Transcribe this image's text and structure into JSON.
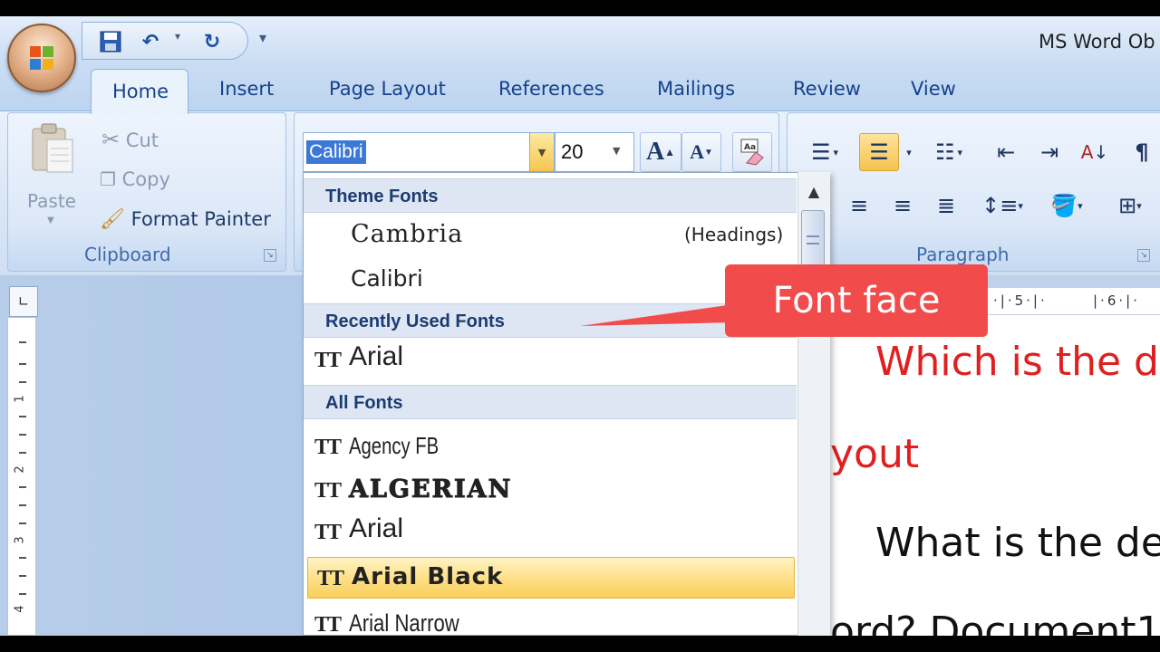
{
  "window": {
    "title": "MS Word Ob"
  },
  "qat": {
    "customize_glyph": "▾"
  },
  "tabs": [
    {
      "label": "Home"
    },
    {
      "label": "Insert"
    },
    {
      "label": "Page Layout"
    },
    {
      "label": "References"
    },
    {
      "label": "Mailings"
    },
    {
      "label": "Review"
    },
    {
      "label": "View"
    }
  ],
  "clipboard": {
    "paste": "Paste",
    "cut": "Cut",
    "copy": "Copy",
    "format_painter": "Format Painter",
    "group_label": "Clipboard"
  },
  "font": {
    "name_value": "Calibri",
    "size_value": "20"
  },
  "paragraph": {
    "group_label": "Paragraph"
  },
  "dropdown": {
    "theme_fonts_header": "Theme Fonts",
    "theme_fonts": [
      {
        "name": "Cambria",
        "note": "(Headings)"
      },
      {
        "name": "Calibri",
        "note": ""
      }
    ],
    "recent_header": "Recently Used Fonts",
    "recent_fonts": [
      {
        "name": "Arial"
      }
    ],
    "all_header": "All Fonts",
    "all_fonts": [
      {
        "name": "Agency FB"
      },
      {
        "name": "ALGERIAN"
      },
      {
        "name": "Arial"
      },
      {
        "name": "Arial Black",
        "selected": true
      },
      {
        "name": "Arial Narrow"
      }
    ]
  },
  "callout": {
    "text": "Font face"
  },
  "document": {
    "line1": "Which is the d",
    "line2": "yout",
    "line3": "What is the de",
    "line4": "ord? Document1"
  },
  "ruler": {
    "h_marks": [
      "5",
      "6"
    ],
    "v_marks": [
      "1",
      "2",
      "3",
      "4"
    ]
  },
  "colors": {
    "accent_text": "#e02020",
    "highlight": "#f7c64f",
    "callout": "#f24b4b"
  }
}
